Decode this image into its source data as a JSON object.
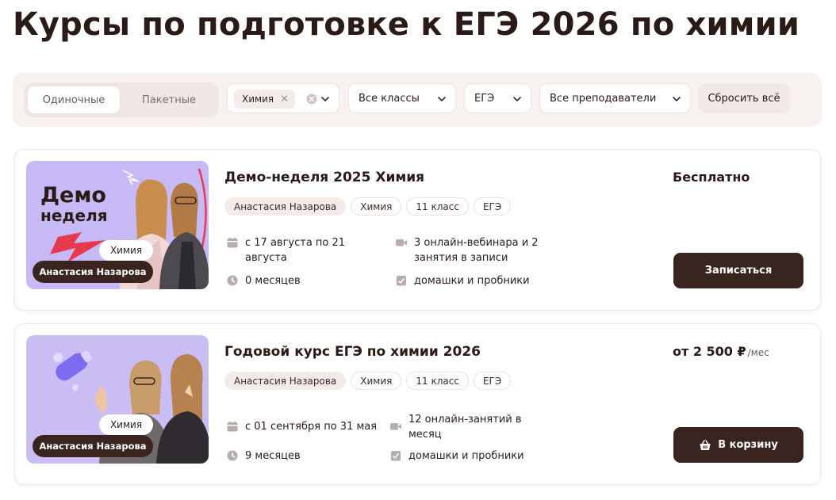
{
  "page": {
    "title": "Курсы по подготовке к ЕГЭ 2026 по химии"
  },
  "filters": {
    "segments": [
      {
        "label": "Одиночные",
        "active": true
      },
      {
        "label": "Пакетные",
        "active": false
      }
    ],
    "subject_chip": "Химия",
    "grade_select": "Все классы",
    "exam_select": "ЕГЭ",
    "teacher_select": "Все преподаватели",
    "reset_label": "Сбросить всё"
  },
  "courses": [
    {
      "title": "Демо-неделя 2025 Химия",
      "tags": [
        "Анастасия Назарова",
        "Химия",
        "11 класс",
        "ЕГЭ"
      ],
      "dates": "с 17 августа по 21 августа",
      "duration": "0 месяцев",
      "lessons": "3 онлайн-вебинара и 2 занятия в записи",
      "homework": "домашки и пробники",
      "price": "Бесплатно",
      "price_unit": "",
      "cta": "Записаться",
      "cta_icon": "",
      "thumb": {
        "headline_1": "Демо",
        "headline_2": "неделя",
        "subject_badge": "Химия",
        "teacher_badge": "Анастасия Назарова",
        "bg": "#c7b9f5"
      }
    },
    {
      "title": "Годовой курс ЕГЭ по химии 2026",
      "tags": [
        "Анастасия Назарова",
        "Химия",
        "11 класс",
        "ЕГЭ"
      ],
      "dates": "с 01 сентября по 31 мая",
      "duration": "9 месяцев",
      "lessons": "12 онлайн-занятий в месяц",
      "homework": "домашки и пробники",
      "price": "от 2 500 ₽",
      "price_unit": "/мес",
      "cta": "В корзину",
      "cta_icon": "basket-icon",
      "thumb": {
        "headline_1": "",
        "headline_2": "",
        "subject_badge": "Химия",
        "teacher_badge": "Анастасия Назарова",
        "bg": "#c9bdf3"
      }
    }
  ],
  "colors": {
    "accent_dark": "#3a2420",
    "filter_bg": "#f7f1ef",
    "tag_teacher_bg": "#f4ebe8"
  }
}
